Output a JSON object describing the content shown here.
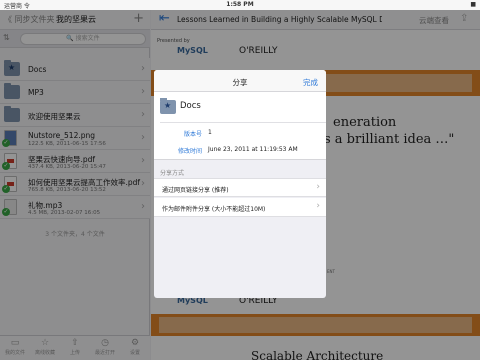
{
  "status_bar": {
    "carrier": "运营商 令",
    "time": "1:58 PM",
    "battery": "■"
  },
  "left_panel": {
    "back_label": "《 同步文件夹",
    "title": "我的坚果云",
    "add_icon": "plus-icon",
    "sort_icon": "sort-icon",
    "search_placeholder": "🔍 搜索文件",
    "items": [
      {
        "name": "Docs",
        "meta": "",
        "type": "folder-star"
      },
      {
        "name": "MP3",
        "meta": "",
        "type": "folder"
      },
      {
        "name": "欢迎使用坚果云",
        "meta": "",
        "type": "folder"
      },
      {
        "name": "Nutstore_512.png",
        "meta": "122.5 KB, 2011-06-15 17:56",
        "type": "png"
      },
      {
        "name": "坚果云快速向导.pdf",
        "meta": "437.4 KB, 2013-06-20 15:47",
        "type": "pdf"
      },
      {
        "name": "如何使用坚果云提高工作效率.pdf",
        "meta": "765.8 KB, 2013-06-20 13:52",
        "type": "pdf"
      },
      {
        "name": "礼物.mp3",
        "meta": "4.5 MB, 2013-02-07 16:05",
        "type": "mp3"
      }
    ],
    "summary": "3 个文件夹，4 个文件",
    "tabs": [
      {
        "label": "我的文件",
        "icon": "folder-icon"
      },
      {
        "label": "离线收藏",
        "icon": "star-icon"
      },
      {
        "label": "上传",
        "icon": "upload-icon"
      },
      {
        "label": "最近打开",
        "icon": "clock-icon"
      },
      {
        "label": "设置",
        "icon": "gear-icon"
      }
    ]
  },
  "right_panel": {
    "back_icon": "back-arrow-icon",
    "doc_title": "Lessons Learned in Building a Highly Scalable MySQL Databa...",
    "cloud_view": "云端查看",
    "share_icon": "share-icon",
    "slide": {
      "presented_by": "Presented by",
      "mysql": "MySQL",
      "oreilly": "O'REILLY",
      "heading1": "eneration",
      "heading2": "s a brilliant idea …\"",
      "small": "ENT",
      "heading3": "Scalable Architecture"
    }
  },
  "popover": {
    "title": "分享",
    "done": "完成",
    "folder_name": "Docs",
    "version_label": "版本号",
    "version_value": "1",
    "modified_label": "修改时间",
    "modified_value": "June 23, 2011 at 11:19:53 AM",
    "section_label": "分享方式",
    "options": [
      "通过网页链接分享 (推荐)",
      "作为邮件附件分享 (大小不能超过10M)"
    ]
  },
  "colors": {
    "accent": "#2f7ad8",
    "folder": "#7f93ad",
    "orange": "#e2852a",
    "check": "#3aa845"
  }
}
